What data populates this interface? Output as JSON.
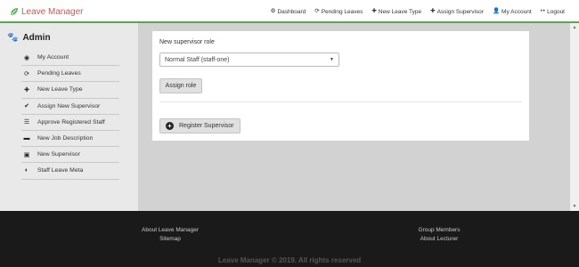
{
  "navbar": {
    "brand": "Leave Manager",
    "links": [
      {
        "icon": "dashboard-icon",
        "label": "Dashboard"
      },
      {
        "icon": "refresh-icon",
        "label": "Pending Leaves"
      },
      {
        "icon": "plus-icon",
        "label": "New Leave Type"
      },
      {
        "icon": "plus-icon",
        "label": "Assign Supervisor"
      },
      {
        "icon": "user-icon",
        "label": "My Account"
      },
      {
        "icon": "logout-icon",
        "label": "Logout"
      }
    ]
  },
  "sidebar": {
    "title": "Admin",
    "items": [
      {
        "icon": "account-icon",
        "label": "My Account"
      },
      {
        "icon": "refresh-icon",
        "label": "Pending Leaves"
      },
      {
        "icon": "plus-icon",
        "label": "New Leave Type"
      },
      {
        "icon": "check-icon",
        "label": "Assign New Supervisor"
      },
      {
        "icon": "list-icon",
        "label": "Approve Registered Staff"
      },
      {
        "icon": "briefcase-icon",
        "label": "New Job Description"
      },
      {
        "icon": "contact-icon",
        "label": "New Supervisor"
      },
      {
        "icon": "half-circle-icon",
        "label": "Staff Leave Meta"
      }
    ]
  },
  "form": {
    "role_label": "New supervisor role",
    "role_selected": "Normal Staff (staff-one)",
    "assign_button": "Assign role",
    "register_button": "Register Supervisor"
  },
  "footer": {
    "left_links": [
      "About Leave Manager",
      "Sitemap"
    ],
    "right_links": [
      "Group Members",
      "About Lecturer"
    ],
    "copyright": "Leave Manager © 2019. All rights reserved"
  },
  "colors": {
    "brand": "#d9534f",
    "nav_accent": "#58a94a",
    "footer_bg": "#1a1a1a"
  }
}
